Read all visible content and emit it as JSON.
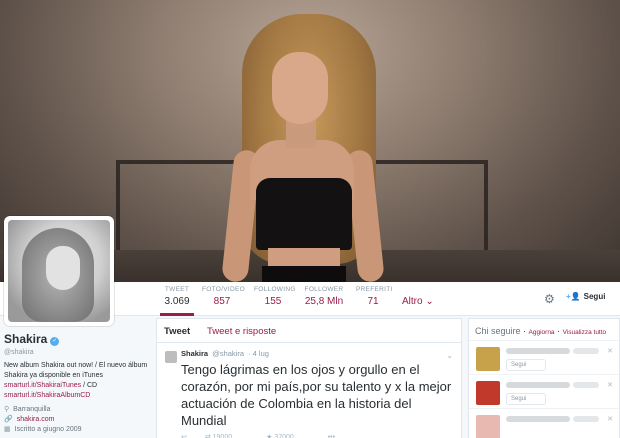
{
  "profile": {
    "name": "Shakira",
    "handle": "@shakira",
    "bio_text": "New album Shakira out now! / El nuevo álbum Shakira ya disponible en iTunes",
    "link_itunes": "smarturl.it/ShakiraiTunes",
    "link_sep": " / CD",
    "link_cd": "smarturl.it/ShakiraAlbumCD",
    "location": "Barranquilla",
    "website": "shakira.com",
    "joined": "Iscritto a giugno 2009"
  },
  "nav": {
    "stats": [
      {
        "label": "TWEET",
        "value": "3.069"
      },
      {
        "label": "FOTO/VIDEO",
        "value": "857"
      },
      {
        "label": "FOLLOWING",
        "value": "155"
      },
      {
        "label": "FOLLOWER",
        "value": "25,8 Mln"
      },
      {
        "label": "PREFERITI",
        "value": "71"
      }
    ],
    "more": "Altro",
    "follow": "Segui"
  },
  "timeline": {
    "tab_tweets": "Tweet",
    "tab_replies": "Tweet e risposte",
    "tweet": {
      "name": "Shakira",
      "handle": "@shakira",
      "date": "· 4 lug",
      "text": "Tengo lágrimas en los ojos y orgullo en el corazón, por mi país,por su talento y x la mejor actuación de Colombia en la historia del Mundial",
      "retweets": "19000",
      "favorites": "37000"
    }
  },
  "who_to_follow": {
    "title": "Chi seguire",
    "refresh": "Aggiorna",
    "view_all": "Visualizza tutto",
    "follow_label": "Segui",
    "colors": [
      "#c8a24a",
      "#c0392b",
      "#e8b9b0"
    ]
  },
  "colors": {
    "accent": "#9b1b4a",
    "verified": "#55acee"
  }
}
